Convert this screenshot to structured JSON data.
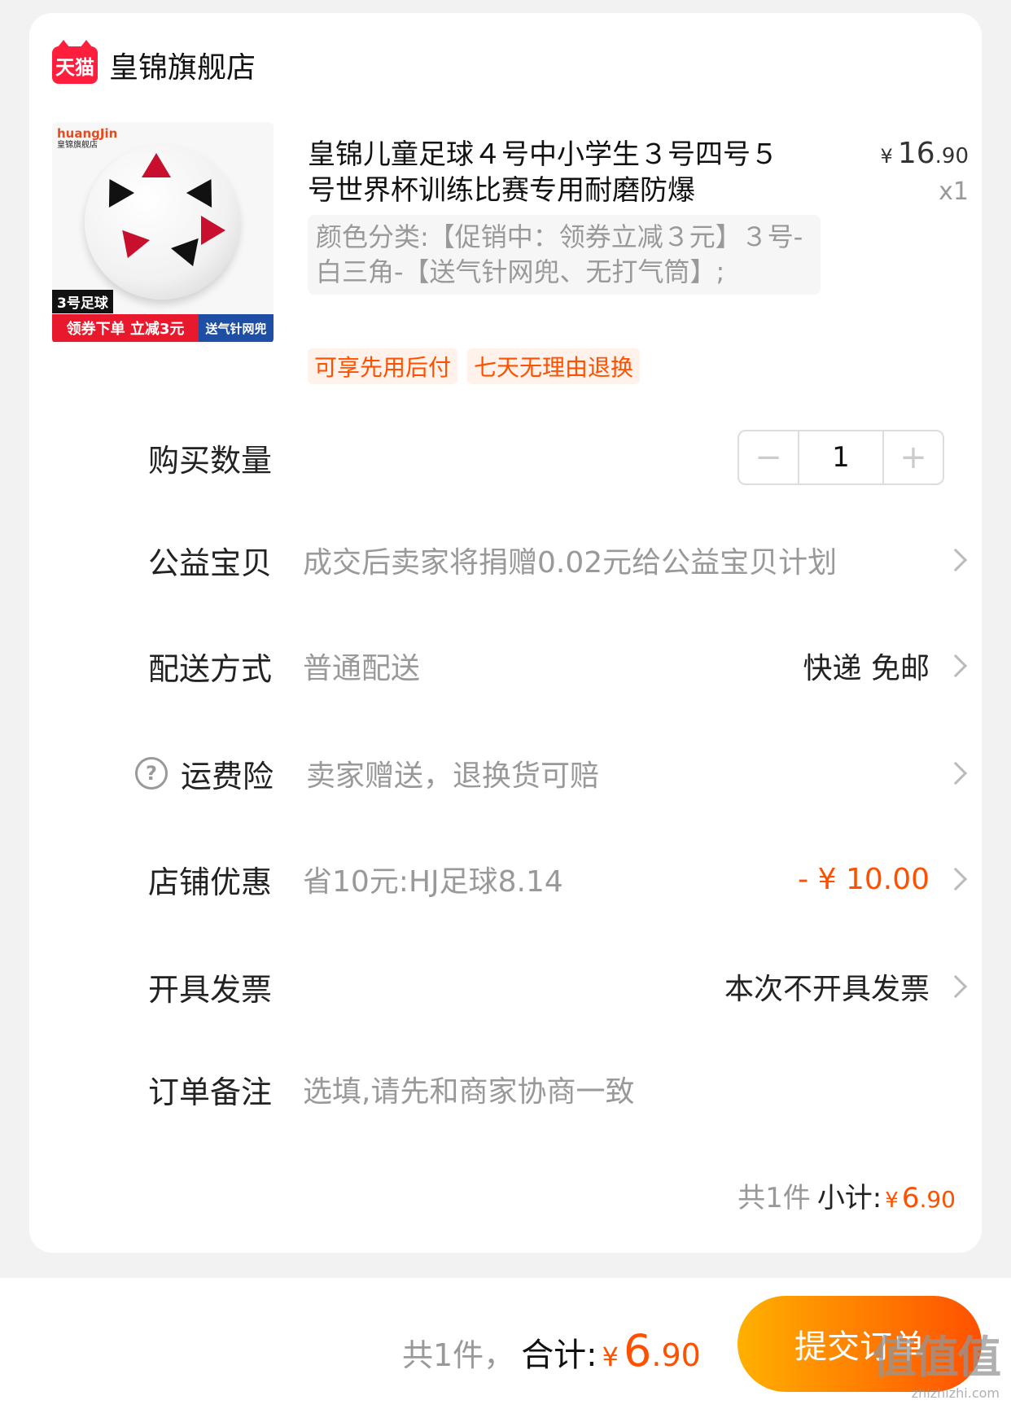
{
  "store": {
    "badge": "天猫",
    "name": "皇锦旗舰店"
  },
  "product": {
    "image": {
      "brand": "huangJin",
      "brand_sub": "皇锦旗舰店",
      "size_tag": "3号足球",
      "promo_left": "领券下单 立减3元",
      "promo_right": "送气针网兜"
    },
    "title": "皇锦儿童足球４号中小学生３号四号５号世界杯训练比赛专用耐磨防爆",
    "price_symbol": "¥",
    "price_int": "16",
    "price_dec": ".90",
    "quantity_label": "x1",
    "sku": "颜色分类:【促销中：领券立减３元】３号-白三角-【送气针网兜、无打气筒】;",
    "badges": [
      "可享先用后付",
      "七天无理由退换"
    ]
  },
  "rows": {
    "quantity": {
      "label": "购买数量",
      "minus": "−",
      "value": "1",
      "plus": "+"
    },
    "charity": {
      "label": "公益宝贝",
      "value": "成交后卖家将捐赠0.02元给公益宝贝计划"
    },
    "delivery": {
      "label": "配送方式",
      "value": "普通配送",
      "right": "快递 免邮"
    },
    "insurance": {
      "icon": "?",
      "label": "运费险",
      "value": "卖家赠送，退换货可赔"
    },
    "discount": {
      "label": "店铺优惠",
      "value": "省10元:HJ足球8.14",
      "right": "- ¥ 10.00"
    },
    "invoice": {
      "label": "开具发票",
      "right": "本次不开具发票"
    },
    "remark": {
      "label": "订单备注",
      "placeholder": "选填,请先和商家协商一致"
    }
  },
  "subtotal": {
    "count": "共1件",
    "label": "小计:",
    "symbol": "¥",
    "int": "6",
    "dec": ".90"
  },
  "bottom": {
    "count": "共1件，",
    "label": "合计:",
    "symbol": "¥",
    "int": "6",
    "dec": ".90",
    "submit": "提交订单"
  },
  "watermark": {
    "main": "值值值",
    "sub": "zhizhizhi.com"
  }
}
